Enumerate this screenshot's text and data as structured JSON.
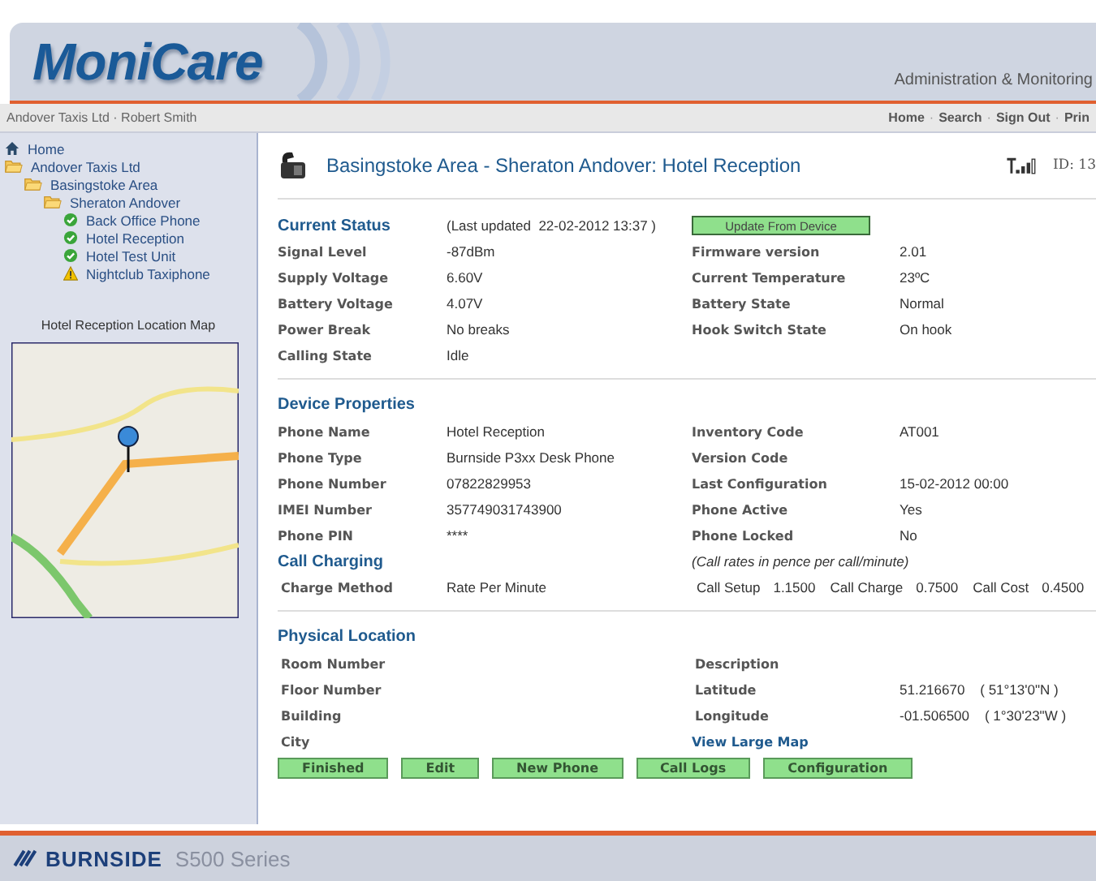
{
  "header": {
    "logo": "MoniCare",
    "tagline": "Administration & Monitoring"
  },
  "nav_bar": {
    "user": "Andover Taxis Ltd · Robert Smith",
    "links": [
      "Home",
      "Search",
      "Sign Out",
      "Prin"
    ],
    "separator": "·"
  },
  "sidebar": {
    "tree": [
      {
        "label": "Home",
        "kind": "home"
      },
      {
        "label": "Andover Taxis Ltd",
        "kind": "folder",
        "children": [
          {
            "label": "Basingstoke Area",
            "kind": "folder",
            "children": [
              {
                "label": "Sheraton Andover",
                "kind": "folder",
                "children": [
                  {
                    "label": "Back Office Phone",
                    "kind": "ok"
                  },
                  {
                    "label": "Hotel Reception",
                    "kind": "ok"
                  },
                  {
                    "label": "Hotel Test Unit",
                    "kind": "ok"
                  },
                  {
                    "label": "Nightclub Taxiphone",
                    "kind": "warning"
                  }
                ]
              }
            ]
          }
        ]
      }
    ],
    "map_title": "Hotel Reception Location Map"
  },
  "page": {
    "title": "Basingstoke Area - Sheraton Andover: Hotel Reception",
    "id": "ID: 13"
  },
  "current_status": {
    "heading": "Current Status",
    "last_updated": "(Last updated  22-02-2012 13:37 )",
    "update_button": "Update From Device",
    "fields": [
      {
        "label": "Signal Level",
        "value": "-87dBm"
      },
      {
        "label": "Firmware version",
        "value": "2.01"
      },
      {
        "label": "Supply Voltage",
        "value": "6.60V"
      },
      {
        "label": "Current Temperature",
        "value": "23ºC"
      },
      {
        "label": "Battery Voltage",
        "value": "4.07V"
      },
      {
        "label": "Battery State",
        "value": "Normal"
      },
      {
        "label": "Power Break",
        "value": "No breaks"
      },
      {
        "label": "Hook Switch State",
        "value": "On hook"
      },
      {
        "label": "Calling State",
        "value": "Idle"
      }
    ]
  },
  "device_properties": {
    "heading": "Device Properties",
    "fields": [
      {
        "label": "Phone Name",
        "value": "Hotel Reception"
      },
      {
        "label": "Inventory Code",
        "value": "AT001"
      },
      {
        "label": "Phone Type",
        "value": "Burnside P3xx Desk Phone"
      },
      {
        "label": "Version Code"
      },
      {
        "label": "Phone Number",
        "value": "07822829953"
      },
      {
        "label": "Last Configuration",
        "value": "15-02-2012 00:00"
      },
      {
        "label": "IMEI Number",
        "value": "357749031743900"
      },
      {
        "label": "Phone Active",
        "value": "Yes"
      },
      {
        "label": "Phone PIN",
        "value": "****"
      },
      {
        "label": "Phone Locked",
        "value": "No"
      }
    ]
  },
  "call_charging": {
    "heading": "Call Charging",
    "note": "(Call rates in pence per call/minute)",
    "method_label": "Charge Method",
    "method_value": "Rate Per Minute",
    "rates": [
      {
        "label": "Call Setup",
        "value": "1.1500"
      },
      {
        "label": "Call Charge",
        "value": "0.7500"
      },
      {
        "label": "Call Cost",
        "value": "0.4500"
      }
    ]
  },
  "physical_location": {
    "heading": "Physical Location",
    "fields": [
      {
        "label": "Room Number"
      },
      {
        "label": "Description"
      },
      {
        "label": "Floor Number"
      },
      {
        "label": "Latitude",
        "value": "51.216670    ( 51°13'0\"N )"
      },
      {
        "label": "Building"
      },
      {
        "label": "Longitude",
        "value": "-01.506500    ( 1°30'23\"W )"
      },
      {
        "label": "City"
      }
    ],
    "map_link": "View Large Map"
  },
  "buttons": [
    "Finished",
    "Edit",
    "New Phone",
    "Call Logs",
    "Configuration"
  ],
  "footer": {
    "brand": "BURNSIDE",
    "series": "S500 Series"
  }
}
